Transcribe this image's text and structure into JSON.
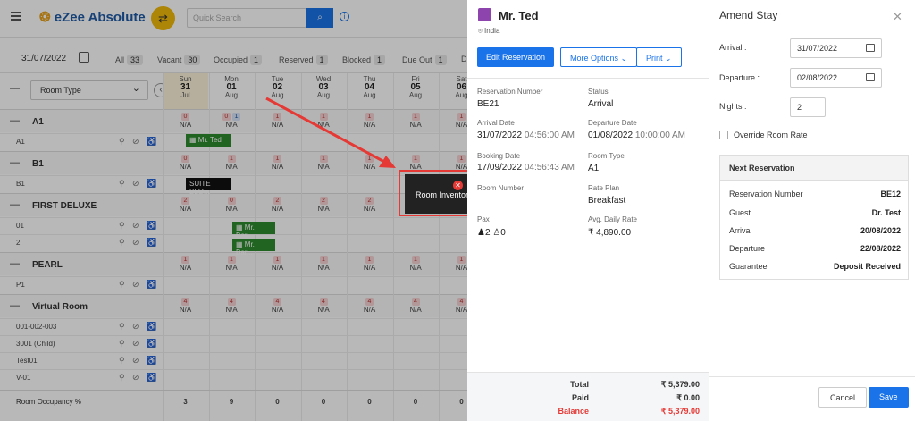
{
  "app": {
    "logo": "eZee Absolute",
    "search_placeholder": "Quick Search"
  },
  "toolbar": {
    "date": "31/07/2022",
    "filters": [
      {
        "label": "All",
        "count": "33"
      },
      {
        "label": "Vacant",
        "count": "30"
      },
      {
        "label": "Occupied",
        "count": "1"
      },
      {
        "label": "Reserved",
        "count": "1"
      },
      {
        "label": "Blocked",
        "count": "1"
      },
      {
        "label": "Due Out",
        "count": "1"
      },
      {
        "label": "D",
        "count": ""
      }
    ]
  },
  "grid": {
    "room_type_label": "Room Type",
    "days": [
      {
        "dow": "Sun",
        "d": "31",
        "m": "Jul"
      },
      {
        "dow": "Mon",
        "d": "01",
        "m": "Aug"
      },
      {
        "dow": "Tue",
        "d": "02",
        "m": "Aug"
      },
      {
        "dow": "Wed",
        "d": "03",
        "m": "Aug"
      },
      {
        "dow": "Thu",
        "d": "04",
        "m": "Aug"
      },
      {
        "dow": "Fri",
        "d": "05",
        "m": "Aug"
      },
      {
        "dow": "Sat",
        "d": "06",
        "m": "Aug"
      }
    ],
    "categories": [
      {
        "name": "A1",
        "avail": [
          "0",
          "0",
          "1",
          "1",
          "1",
          "1",
          "1"
        ],
        "rooms": [
          "A1"
        ]
      },
      {
        "name": "B1",
        "avail": [
          "0",
          "1",
          "1",
          "1",
          "1",
          "1",
          "1"
        ],
        "rooms": [
          "B1"
        ]
      },
      {
        "name": "FIRST DELUXE",
        "avail": [
          "2",
          "0",
          "2",
          "2",
          "2",
          "2",
          "2"
        ],
        "rooms": [
          "01",
          "2"
        ]
      },
      {
        "name": "PEARL",
        "avail": [
          "1",
          "1",
          "1",
          "1",
          "1",
          "1",
          "1"
        ],
        "rooms": [
          "P1"
        ]
      },
      {
        "name": "Virtual Room",
        "avail": [
          "4",
          "4",
          "4",
          "4",
          "4",
          "4",
          "4"
        ],
        "rooms": [
          "001-002-003",
          "3001 (Child)",
          "Test01",
          "V-01"
        ]
      }
    ],
    "na": "N/A",
    "bookings": {
      "a1": "Mr. Ted",
      "b1": "SUITE BLO...",
      "fd1": "Mr. Bar...",
      "fd2": "Mr. Bar..."
    },
    "occupancy_label": "Room Occupancy %",
    "occupancy": [
      "3",
      "9",
      "0",
      "0",
      "0",
      "0",
      "0"
    ]
  },
  "toast": {
    "message": "Room Inventory is zero."
  },
  "reservation": {
    "guest": "Mr. Ted",
    "country": "India",
    "edit_label": "Edit Reservation",
    "more_label": "More Options",
    "print_label": "Print",
    "number_label": "Reservation Number",
    "number": "BE21",
    "status_label": "Status",
    "status": "Arrival",
    "arrival_label": "Arrival Date",
    "arrival_date": "31/07/2022",
    "arrival_time": "04:56:00 AM",
    "departure_label": "Departure Date",
    "departure_date": "01/08/2022",
    "departure_time": "10:00:00 AM",
    "booking_label": "Booking Date",
    "booking_date": "17/09/2022",
    "booking_time": "04:56:43 AM",
    "roomtype_label": "Room Type",
    "roomtype": "A1",
    "roomnum_label": "Room Number",
    "rateplan_label": "Rate Plan",
    "rateplan": "Breakfast",
    "pax_label": "Pax",
    "pax_adult": "2",
    "pax_child": "0",
    "adr_label": "Avg. Daily Rate",
    "adr": "₹ 4,890.00",
    "total_label": "Total",
    "total": "₹ 5,379.00",
    "paid_label": "Paid",
    "paid": "₹ 0.00",
    "balance_label": "Balance",
    "balance": "₹ 5,379.00"
  },
  "amend": {
    "title": "Amend Stay",
    "arrival_label": "Arrival :",
    "arrival": "31/07/2022",
    "departure_label": "Departure :",
    "departure": "02/08/2022",
    "nights_label": "Nights :",
    "nights": "2",
    "override_label": "Override Room Rate",
    "next_title": "Next Reservation",
    "next": [
      {
        "k": "Reservation Number",
        "v": "BE12"
      },
      {
        "k": "Guest",
        "v": "Dr. Test"
      },
      {
        "k": "Arrival",
        "v": "20/08/2022"
      },
      {
        "k": "Departure",
        "v": "22/08/2022"
      },
      {
        "k": "Guarantee",
        "v": "Deposit Received"
      }
    ],
    "cancel_label": "Cancel",
    "save_label": "Save"
  },
  "colors": {
    "accent": "#1a73e8",
    "booking": "#2e8b2e",
    "alert": "#e53935"
  }
}
